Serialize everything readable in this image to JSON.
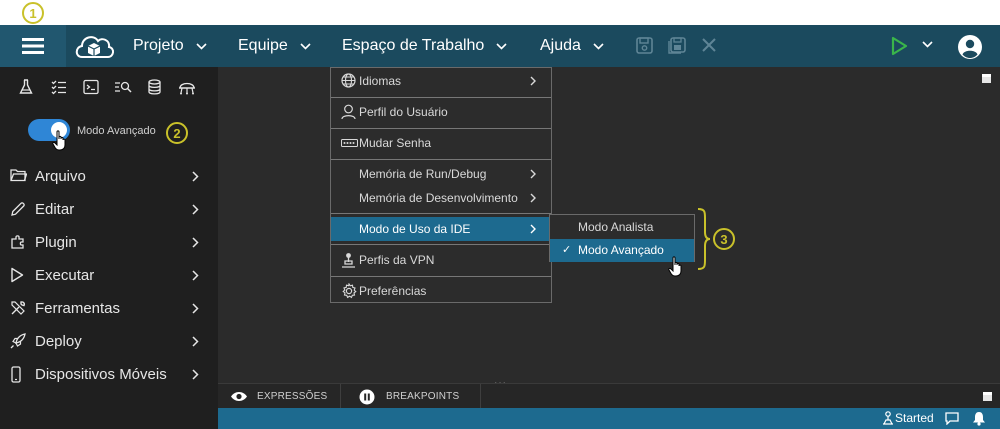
{
  "callouts": [
    "1",
    "2",
    "3"
  ],
  "header": {
    "menus": [
      {
        "label": "Projeto"
      },
      {
        "label": "Equipe"
      },
      {
        "label": "Espaço de Trabalho"
      },
      {
        "label": "Ajuda"
      }
    ]
  },
  "sidebar": {
    "toggle_label": "Modo Avançado",
    "toggle_on": true,
    "tool_icons": [
      "flask-icon",
      "checklist-icon",
      "terminal-icon",
      "search-list-icon",
      "database-icon",
      "robot-icon"
    ],
    "items": [
      {
        "label": "Arquivo",
        "icon": "folder-icon"
      },
      {
        "label": "Editar",
        "icon": "pencil-icon"
      },
      {
        "label": "Plugin",
        "icon": "plugin-icon"
      },
      {
        "label": "Executar",
        "icon": "play-icon"
      },
      {
        "label": "Ferramentas",
        "icon": "tools-icon"
      },
      {
        "label": "Deploy",
        "icon": "rocket-icon"
      },
      {
        "label": "Dispositivos Móveis",
        "icon": "mobile-icon"
      }
    ]
  },
  "dropdown": {
    "items": [
      {
        "label": "Idiomas",
        "icon": "globe-icon",
        "submenu": true
      },
      {
        "label": "Perfil do Usuário",
        "icon": "user-icon",
        "submenu": false
      },
      {
        "label": "Mudar Senha",
        "icon": "password-icon",
        "submenu": false
      },
      {
        "label": "Memória de Run/Debug",
        "icon": "",
        "submenu": true
      },
      {
        "label": "Memória de Desenvolvimento",
        "icon": "",
        "submenu": true
      },
      {
        "label": "Modo de Uso da IDE",
        "icon": "",
        "submenu": true,
        "active": true
      },
      {
        "label": "Perfis da VPN",
        "icon": "vpn-icon",
        "submenu": false
      },
      {
        "label": "Preferências",
        "icon": "gear-icon",
        "submenu": false
      }
    ]
  },
  "submenu": {
    "items": [
      {
        "label": "Modo Analista",
        "checked": false
      },
      {
        "label": "Modo Avançado",
        "checked": true
      }
    ],
    "check_glyph": "✓"
  },
  "bottom_panel": {
    "tabs": [
      {
        "label": "EXPRESSÕES",
        "icon": "eye-icon"
      },
      {
        "label": "BREAKPOINTS",
        "icon": "pause-icon"
      }
    ]
  },
  "splitter_dots": "...",
  "status": {
    "text": "Started"
  },
  "colors": {
    "header": "#1b4a5e",
    "sidebar": "#1f1f1f",
    "editor": "#2b2b2b",
    "accent": "#1d6a8f",
    "toggle": "#2f86d6",
    "callout": "#c9c12a",
    "run": "#3ab54a"
  }
}
